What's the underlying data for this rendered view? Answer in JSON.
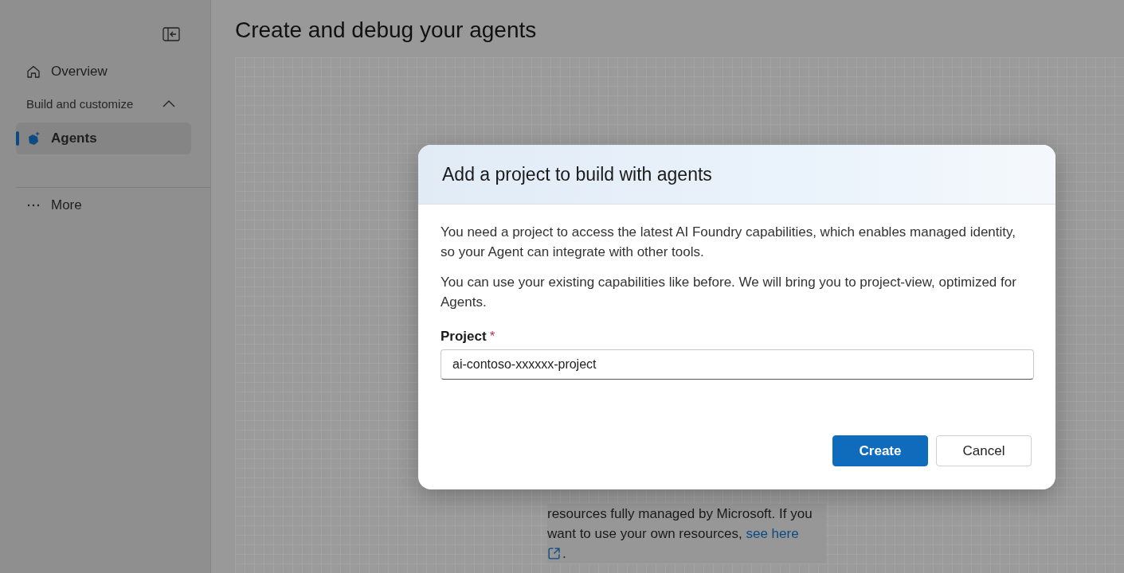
{
  "sidebar": {
    "items": [
      {
        "kind": "link",
        "label": "Overview",
        "selected": false
      },
      {
        "kind": "section",
        "label": "Build and customize",
        "expanded": true
      },
      {
        "kind": "link",
        "label": "Agents",
        "selected": true
      },
      {
        "kind": "divider"
      },
      {
        "kind": "link",
        "label": "More",
        "selected": false
      }
    ]
  },
  "page": {
    "title": "Create and debug your agents",
    "note": {
      "text": "resources fully managed by Microsoft. If you want to use your own resources, ",
      "link": "see here",
      "end": "."
    }
  },
  "dialog": {
    "title": "Add a project to build with agents",
    "paragraphs": [
      "You need a project to access the latest AI Foundry capabilities, which enables managed identity, so your Agent can integrate with other tools.",
      "You can use your existing capabilities like before. We will bring you to project-view, optimized for Agents."
    ],
    "field": {
      "label": "Project",
      "required_mark": "*",
      "value": "ai-contoso-xxxxxx-project"
    },
    "buttons": [
      {
        "label": "Create",
        "primary": true
      },
      {
        "label": "Cancel",
        "primary": false
      }
    ]
  }
}
